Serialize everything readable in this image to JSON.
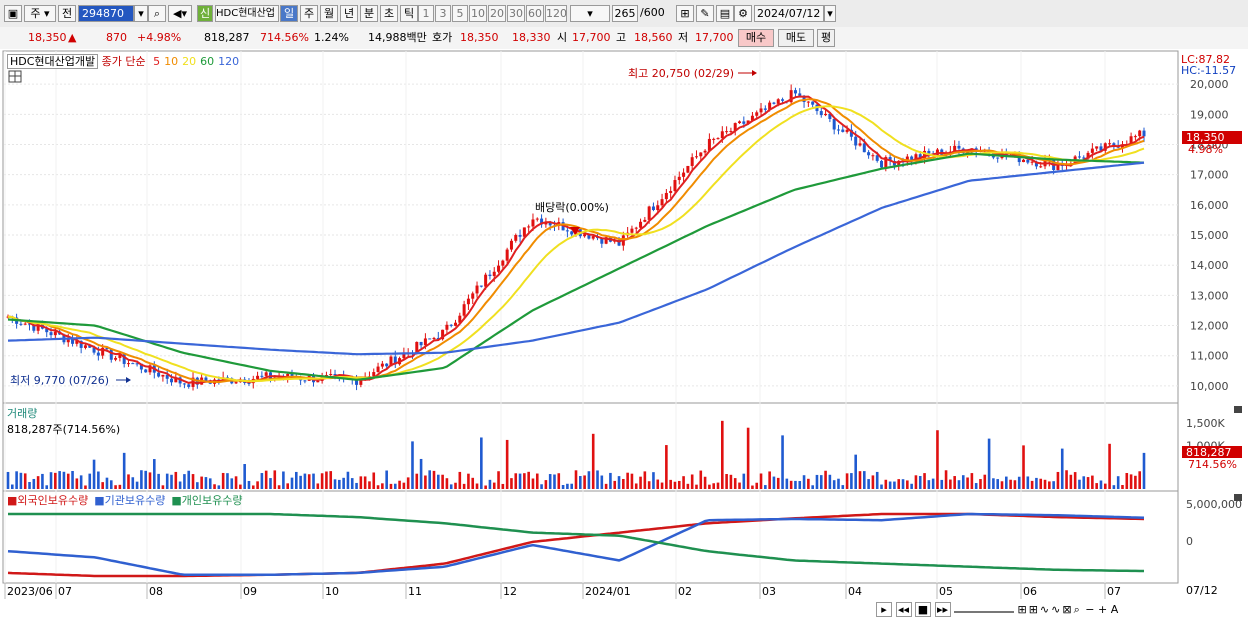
{
  "toolbar": {
    "period_type": "주",
    "prev_label": "전",
    "stock_code": "294870",
    "new_badge": "신",
    "stock_name": "HDC현대산업",
    "periods": [
      "일",
      "주",
      "월",
      "년",
      "분",
      "초",
      "틱"
    ],
    "active_period": "일",
    "intervals": [
      "1",
      "3",
      "5",
      "10",
      "20",
      "30",
      "60",
      "120"
    ],
    "count": "265",
    "count_max": "/600",
    "date": "2024/07/12"
  },
  "info": {
    "price": "18,350",
    "arrow": "▲",
    "change": "870",
    "change_pct": "+4.98%",
    "volume": "818,287",
    "volume_ratio": "714.56%",
    "turnover": "1.24%",
    "amount": "14,988백만",
    "quote_label": "호가",
    "ask": "18,350",
    "bid": "18,330",
    "open_label": "시",
    "open": "17,700",
    "high_label": "고",
    "high": "18,560",
    "low_label": "저",
    "low": "17,700",
    "buy_label": "매수",
    "sell_label": "매도",
    "avg_label": "평"
  },
  "price_panel": {
    "stock_label": "HDC현대산업개발",
    "ma_title": "종가 단순",
    "ma_periods": [
      "5",
      "10",
      "20",
      "60",
      "120"
    ],
    "ma_colors": [
      "#e02020",
      "#f08c00",
      "#f0e020",
      "#1f9a3a",
      "#3a66d8"
    ],
    "lc_label": "LC:87.82",
    "hc_label": "HC:-11.57",
    "y_ticks": [
      "20,000",
      "19,000",
      "18,000",
      "17,000",
      "16,000",
      "15,000",
      "14,000",
      "13,000",
      "12,000",
      "11,000",
      "10,000"
    ],
    "current_price": "18,350",
    "current_pct": "4.98%",
    "high_annotation": "최고 20,750 (02/29)",
    "low_annotation": "최저 9,770 (07/26)",
    "dividend_annotation": "배당락(0.00%)"
  },
  "volume_panel": {
    "title": "거래량",
    "value_label": "818,287주(714.56%)",
    "y_ticks": [
      "1,500K",
      "1,000K"
    ],
    "current_volume": "818,287",
    "current_ratio": "714.56%"
  },
  "holdings_panel": {
    "legend": [
      "외국인보유수량",
      "기관보유수량",
      "개인보유수량"
    ],
    "legend_colors": [
      "#d01818",
      "#3060d0",
      "#1f9050"
    ],
    "y_ticks": [
      "5,000,000",
      "0"
    ]
  },
  "x_axis": {
    "labels": [
      "2023/06",
      "07",
      "08",
      "09",
      "10",
      "11",
      "12",
      "2024/01",
      "02",
      "03",
      "04",
      "05",
      "06",
      "07"
    ],
    "right_label": "07/12"
  },
  "chart_data": {
    "type": "line",
    "title": "HDC현대산업개발",
    "x": [
      "2023/06",
      "07",
      "08",
      "09",
      "10",
      "11",
      "12",
      "2024/01",
      "02",
      "03",
      "04",
      "05",
      "06",
      "07"
    ],
    "ylim": [
      9500,
      20900
    ],
    "series": [
      {
        "name": "종가",
        "values": [
          12300,
          11200,
          10100,
          10300,
          10200,
          11800,
          15600,
          14700,
          18000,
          19700,
          17400,
          17900,
          17300,
          18350
        ]
      },
      {
        "name": "120",
        "values": [
          11500,
          11600,
          11400,
          11200,
          11050,
          11100,
          11500,
          12100,
          13200,
          14600,
          15900,
          16800,
          17100,
          17400
        ]
      },
      {
        "name": "60",
        "values": [
          12200,
          12000,
          11100,
          10500,
          10200,
          10600,
          12500,
          13900,
          15300,
          16500,
          17200,
          17700,
          17500,
          17400
        ]
      }
    ],
    "annotations": [
      "최고 20,750 (02/29)",
      "최저 9,770 (07/26)",
      "배당락(0.00%)"
    ]
  }
}
